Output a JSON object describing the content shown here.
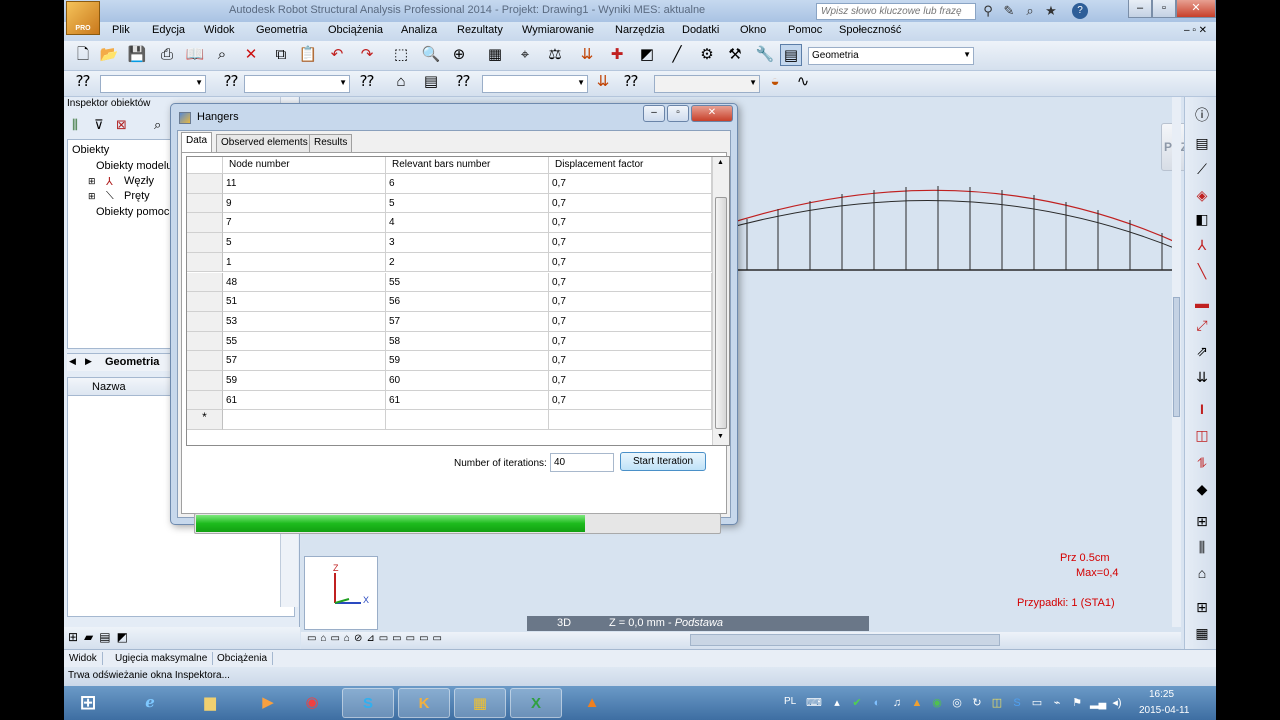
{
  "window": {
    "title": "Autodesk Robot Structural Analysis Professional 2014 - Projekt: Drawing1 - Wyniki MES: aktualne",
    "logo_label": "PRO",
    "search_placeholder": "Wpisz słowo kluczowe lub frazę"
  },
  "menu": [
    "Plik",
    "Edycja",
    "Widok",
    "Geometria",
    "Obciążenia",
    "Analiza",
    "Rezultaty",
    "Wymiarowanie",
    "Narzędzia",
    "Dodatki",
    "Okno",
    "Pomoc",
    "Społeczność"
  ],
  "toolbar": {
    "layout_combo": "Geometria"
  },
  "inspector": {
    "title": "Inspektor obiektów",
    "tree_root": "Obiekty",
    "tree_model": "Obiekty modelu",
    "tree_nodes": "Węzły",
    "tree_bars": "Pręty",
    "tree_aux": "Obiekty pomocnicze",
    "tab_geometry": "Geometria",
    "props_header": "Nazwa"
  },
  "dialog": {
    "title": "Hangers",
    "tabs": [
      "Data",
      "Observed elements",
      "Results"
    ],
    "columns": [
      "Node number",
      "Relevant bars number",
      "Displacement factor"
    ],
    "rows": [
      [
        "11",
        "6",
        "0,7"
      ],
      [
        "9",
        "5",
        "0,7"
      ],
      [
        "7",
        "4",
        "0,7"
      ],
      [
        "5",
        "3",
        "0,7"
      ],
      [
        "1",
        "2",
        "0,7"
      ],
      [
        "48",
        "55",
        "0,7"
      ],
      [
        "51",
        "56",
        "0,7"
      ],
      [
        "53",
        "57",
        "0,7"
      ],
      [
        "55",
        "58",
        "0,7"
      ],
      [
        "57",
        "59",
        "0,7"
      ],
      [
        "59",
        "60",
        "0,7"
      ],
      [
        "61",
        "61",
        "0,7"
      ]
    ],
    "new_row_marker": "*",
    "iterations_label": "Number of iterations:",
    "iterations_value": "40",
    "start_button": "Start Iteration",
    "progress": 0.74
  },
  "view": {
    "orientation_button": "PRZÓD",
    "legend_prz": "Prz  0.5cm",
    "legend_max": "Max=0,4",
    "legend_cases": "Przypadki: 1 (STA1)",
    "mode_3d": "3D",
    "plane_label": "Z = 0,0 mm - ",
    "plane_name": "Podstawa",
    "axis_z": "Z",
    "axis_x": "X"
  },
  "status": {
    "tabs": [
      "Widok",
      "Ugięcia maksymalne",
      "Obciążenia"
    ],
    "message": "Trwa odświeżanie okna Inspektora..."
  },
  "taskbar": {
    "lang": "PL",
    "time": "16:25",
    "date": "2015-04-11"
  },
  "colors": {
    "accent_red": "#d40000",
    "progress_green": "#1dbb1d"
  }
}
